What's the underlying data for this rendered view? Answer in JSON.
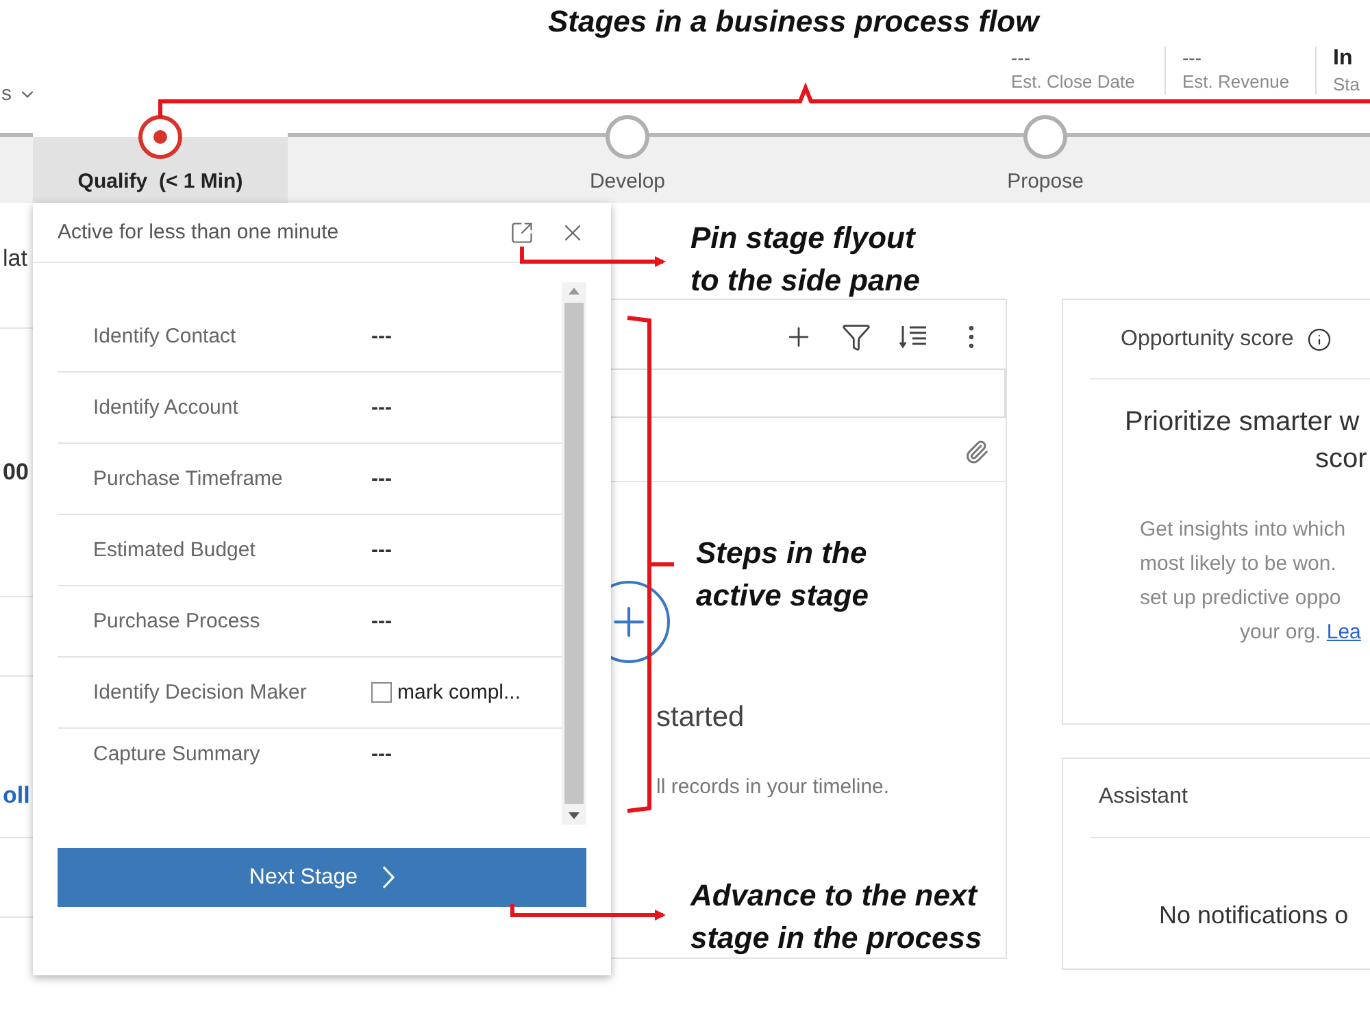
{
  "header": {
    "nav_fragment": "s",
    "fields": [
      {
        "value": "---",
        "label": "Est. Close Date",
        "emphasis": false
      },
      {
        "value": "---",
        "label": "Est. Revenue",
        "emphasis": false
      },
      {
        "value": "In",
        "label": "Sta",
        "emphasis": true
      }
    ]
  },
  "process_flow": {
    "stages": [
      {
        "name": "Qualify",
        "duration": "(< 1 Min)",
        "selected": true
      },
      {
        "name": "Develop",
        "selected": false
      },
      {
        "name": "Propose",
        "selected": false
      }
    ]
  },
  "left_column": {
    "fragments": [
      {
        "text": "lat",
        "kind": "text"
      },
      {
        "text": "00",
        "kind": "number"
      },
      {
        "text": "oll",
        "kind": "link"
      }
    ]
  },
  "stage_flyout": {
    "title": "Active for less than one minute",
    "steps": [
      {
        "label": "Identify Contact",
        "kind": "value",
        "value": "---"
      },
      {
        "label": "Identify Account",
        "kind": "value",
        "value": "---"
      },
      {
        "label": "Purchase Timeframe",
        "kind": "value",
        "value": "---"
      },
      {
        "label": "Estimated Budget",
        "kind": "value",
        "value": "---"
      },
      {
        "label": "Purchase Process",
        "kind": "value",
        "value": "---"
      },
      {
        "label": "Identify Decision Maker",
        "kind": "checkbox",
        "value": "mark compl...",
        "checked": false
      },
      {
        "label": "Capture Summary",
        "kind": "value",
        "value": "---"
      }
    ],
    "button": "Next Stage"
  },
  "timeline": {
    "empty_title": "started",
    "empty_text": "ll records in your timeline."
  },
  "opportunity_score": {
    "title": "Opportunity score",
    "heading": "Prioritize smarter w",
    "heading_rest": "scor",
    "body_lines": [
      "Get insights into which",
      "most likely to be won.",
      "set up predictive oppo"
    ],
    "last_line": "your org.",
    "link": "Lea"
  },
  "assistant": {
    "title": "Assistant",
    "message": "No notifications o"
  },
  "annotations": [
    {
      "lines": [
        "Stages in a business process flow"
      ]
    },
    {
      "lines": [
        "Pin stage flyout",
        "to the side pane"
      ]
    },
    {
      "lines": [
        "Steps in the",
        "active stage"
      ]
    },
    {
      "lines": [
        "Advance to the next",
        "stage in the process"
      ]
    }
  ]
}
